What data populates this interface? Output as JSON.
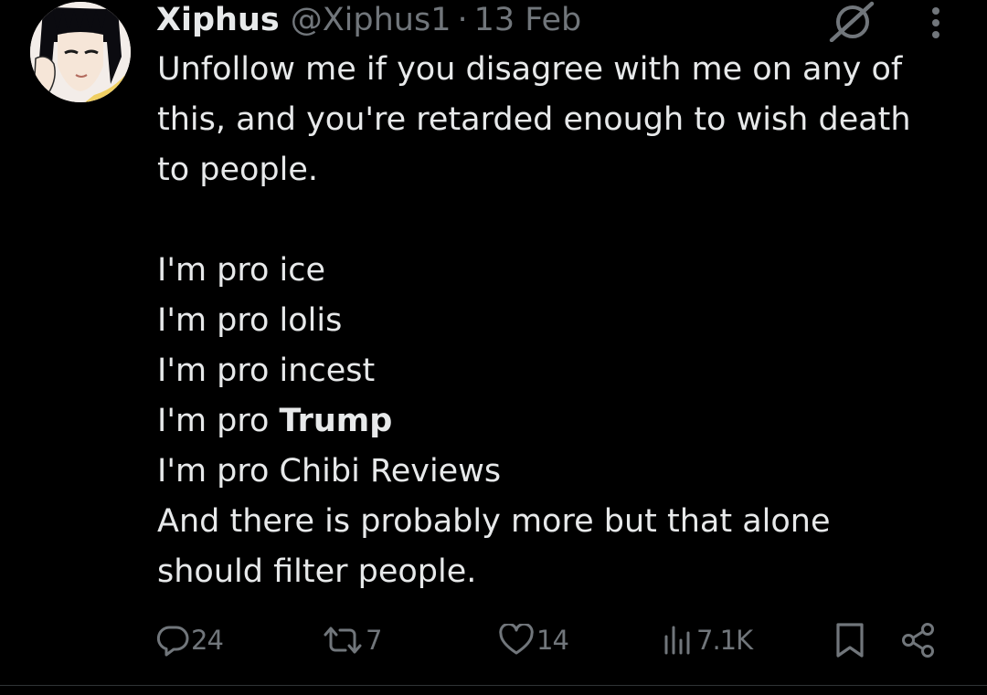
{
  "tweet": {
    "display_name": "Xiphus",
    "handle": "@Xiphus1",
    "separator": "·",
    "time": "13 Feb",
    "lines": [
      "Unfollow me if you disagree with me on any of",
      "this, and you're retarded enough to wish death",
      "to people.",
      "",
      "I'm pro ice",
      "I'm pro lolis",
      "I'm pro incest",
      "I'm pro ",
      "Trump",
      "I'm pro Chibi Reviews",
      "And there is probably more but that alone",
      "should filter people."
    ],
    "stats": {
      "replies": "24",
      "reposts": "7",
      "likes": "14",
      "views": "7.1K"
    }
  },
  "icons": {
    "avatar": "avatar-anime-portrait",
    "grok": "grok-icon",
    "more": "more-options-icon",
    "reply": "reply-icon",
    "repost": "repost-icon",
    "like": "heart-icon",
    "views": "views-icon",
    "bookmark": "bookmark-icon",
    "share": "share-icon"
  },
  "colors": {
    "background": "#000000",
    "text": "#e7e9ea",
    "muted": "#71767b",
    "divider": "#2f3336"
  }
}
